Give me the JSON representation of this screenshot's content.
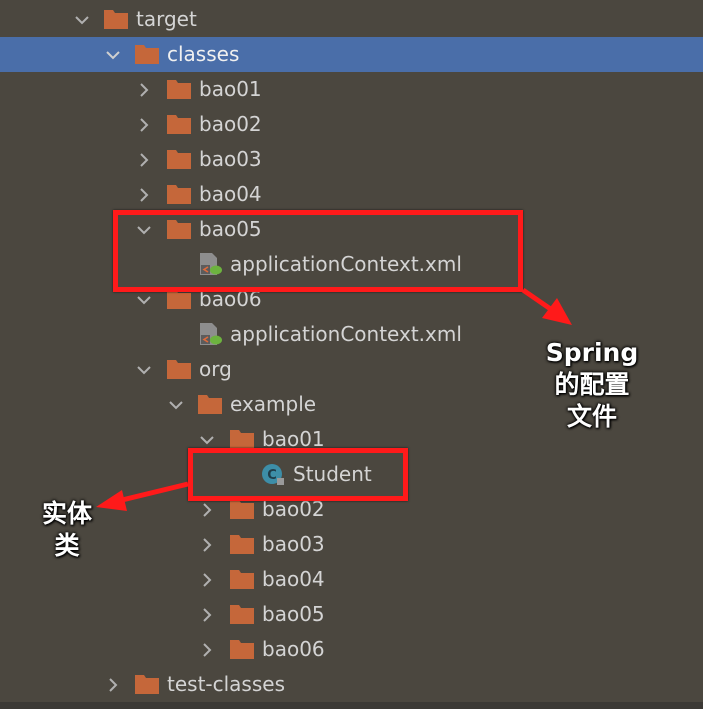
{
  "tree": [
    {
      "label": "target",
      "type": "folder",
      "expanded": true,
      "selected": false
    },
    {
      "label": "classes",
      "type": "folder",
      "expanded": true,
      "selected": true
    },
    {
      "label": "bao01",
      "type": "folder",
      "expanded": false,
      "selected": false
    },
    {
      "label": "bao02",
      "type": "folder",
      "expanded": false,
      "selected": false
    },
    {
      "label": "bao03",
      "type": "folder",
      "expanded": false,
      "selected": false
    },
    {
      "label": "bao04",
      "type": "folder",
      "expanded": false,
      "selected": false
    },
    {
      "label": "bao05",
      "type": "folder",
      "expanded": true,
      "selected": false
    },
    {
      "label": "applicationContext.xml",
      "type": "spring-xml",
      "selected": false
    },
    {
      "label": "bao06",
      "type": "folder",
      "expanded": true,
      "selected": false
    },
    {
      "label": "applicationContext.xml",
      "type": "spring-xml",
      "selected": false
    },
    {
      "label": "org",
      "type": "folder",
      "expanded": true,
      "selected": false
    },
    {
      "label": "example",
      "type": "folder",
      "expanded": true,
      "selected": false
    },
    {
      "label": "bao01",
      "type": "folder",
      "expanded": true,
      "selected": false
    },
    {
      "label": "Student",
      "type": "java-class",
      "selected": false
    },
    {
      "label": "bao02",
      "type": "folder",
      "expanded": false,
      "selected": false
    },
    {
      "label": "bao03",
      "type": "folder",
      "expanded": false,
      "selected": false
    },
    {
      "label": "bao04",
      "type": "folder",
      "expanded": false,
      "selected": false
    },
    {
      "label": "bao05",
      "type": "folder",
      "expanded": false,
      "selected": false
    },
    {
      "label": "bao06",
      "type": "folder",
      "expanded": false,
      "selected": false
    },
    {
      "label": "test-classes",
      "type": "folder",
      "expanded": false,
      "selected": false
    }
  ],
  "annotations": {
    "spring_config_line1": "Spring",
    "spring_config_line2": "的配置",
    "spring_config_line3": "文件",
    "entity_line1": "实体",
    "entity_line2": "类"
  },
  "colors": {
    "background": "#4b473f",
    "selection": "#4a6ea9",
    "folder": "#c5673a",
    "annotation_red": "#ff1a1a",
    "text": "#d4d4d4"
  }
}
